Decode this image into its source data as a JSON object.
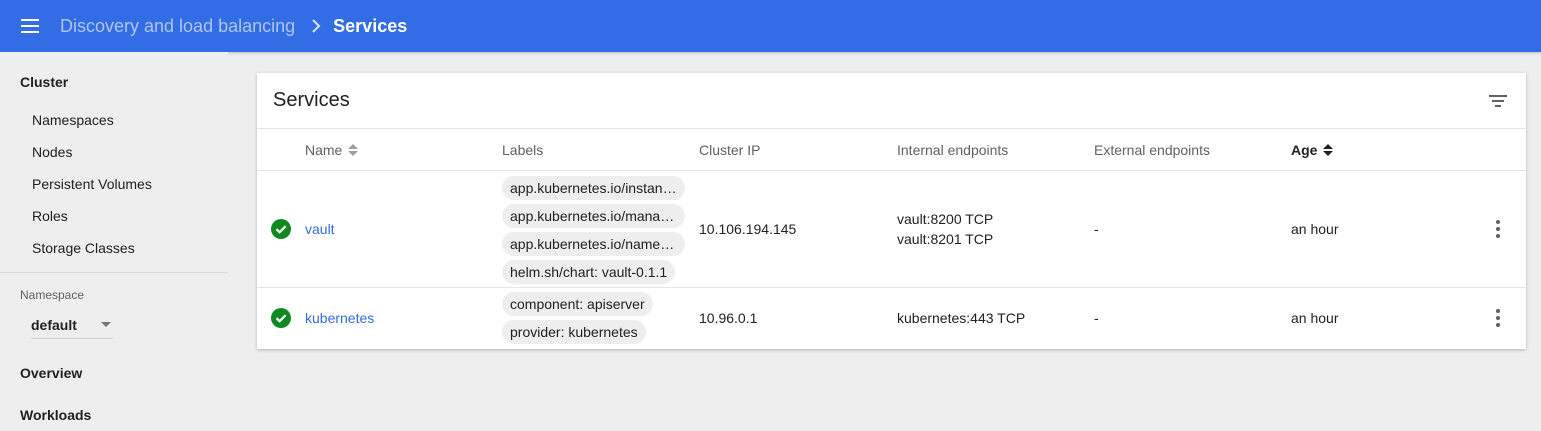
{
  "topbar": {
    "breadcrumb_parent": "Discovery and load balancing",
    "breadcrumb_current": "Services",
    "menu_icon": "menu-icon",
    "separator_icon": "chevron-right-icon"
  },
  "colors": {
    "accent": "#326de6",
    "success": "#0f8a22",
    "background": "#eeeeee"
  },
  "sidebar": {
    "cluster_heading": "Cluster",
    "cluster_items": [
      {
        "label": "Namespaces"
      },
      {
        "label": "Nodes"
      },
      {
        "label": "Persistent Volumes"
      },
      {
        "label": "Roles"
      },
      {
        "label": "Storage Classes"
      }
    ],
    "namespace_label": "Namespace",
    "namespace_value": "default",
    "overview": "Overview",
    "workloads": "Workloads"
  },
  "card": {
    "title": "Services",
    "filter_icon": "filter-icon",
    "columns": {
      "name": "Name",
      "labels": "Labels",
      "cluster_ip": "Cluster IP",
      "internal_endpoints": "Internal endpoints",
      "external_endpoints": "External endpoints",
      "age": "Age"
    },
    "rows": [
      {
        "status_icon": "check-circle-icon",
        "name": "vault",
        "labels": [
          "app.kubernetes.io/instance: vault",
          "app.kubernetes.io/managed-by: Tiller",
          "app.kubernetes.io/name: vault",
          "helm.sh/chart: vault-0.1.1"
        ],
        "cluster_ip": "10.106.194.145",
        "internal_endpoints": [
          "vault:8200 TCP",
          "vault:8201 TCP"
        ],
        "external_endpoints": "-",
        "age": "an hour"
      },
      {
        "status_icon": "check-circle-icon",
        "name": "kubernetes",
        "labels": [
          "component: apiserver",
          "provider: kubernetes"
        ],
        "cluster_ip": "10.96.0.1",
        "internal_endpoints": [
          "kubernetes:443 TCP"
        ],
        "external_endpoints": "-",
        "age": "an hour"
      }
    ]
  }
}
